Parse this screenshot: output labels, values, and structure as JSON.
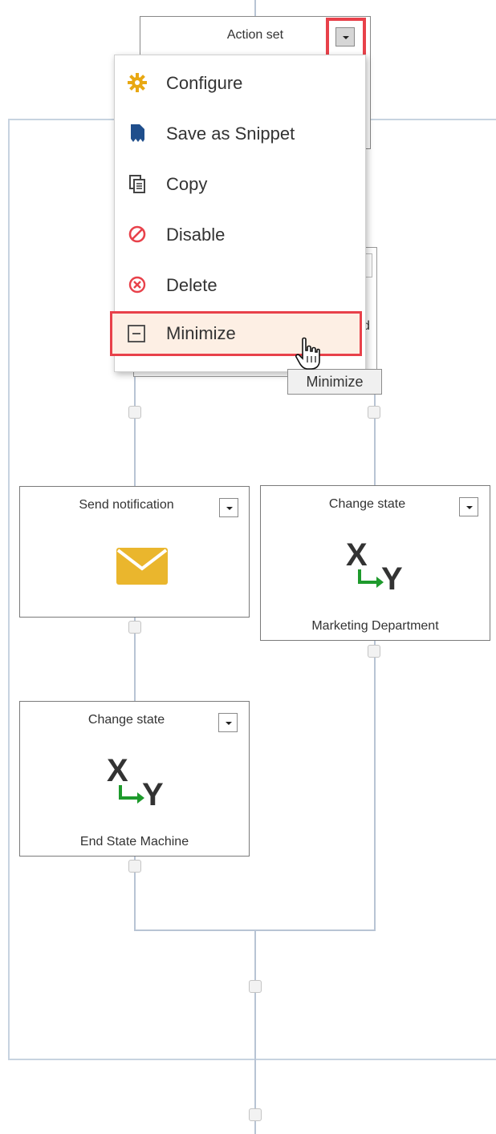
{
  "action_set": {
    "title": "Action set"
  },
  "menu": {
    "items": [
      {
        "label": "Configure",
        "icon": "gear-icon",
        "color": "#e8a813"
      },
      {
        "label": "Save as Snippet",
        "icon": "save-snippet-icon",
        "color": "#1f4e8c"
      },
      {
        "label": "Copy",
        "icon": "copy-icon",
        "color": "#444444"
      },
      {
        "label": "Disable",
        "icon": "disable-icon",
        "color": "#e8414a"
      },
      {
        "label": "Delete",
        "icon": "delete-icon",
        "color": "#e8414a"
      },
      {
        "label": "Minimize",
        "icon": "minimize-icon",
        "color": "#444444"
      }
    ],
    "highlighted": "Minimize"
  },
  "tooltip": {
    "text": "Minimize"
  },
  "cards": {
    "send_notification": {
      "title": "Send notification",
      "icon": "envelope-icon",
      "icon_color": "#eab62d"
    },
    "change_state_marketing": {
      "title": "Change state",
      "subtitle": "Marketing Department",
      "icon": "change-state-icon"
    },
    "change_state_end": {
      "title": "Change state",
      "subtitle": "End State Machine",
      "icon": "change-state-icon"
    }
  },
  "state_icon": {
    "x": "X",
    "y": "Y",
    "arrow_color": "#1e9a2c"
  },
  "highlight_color": "#e8414a"
}
